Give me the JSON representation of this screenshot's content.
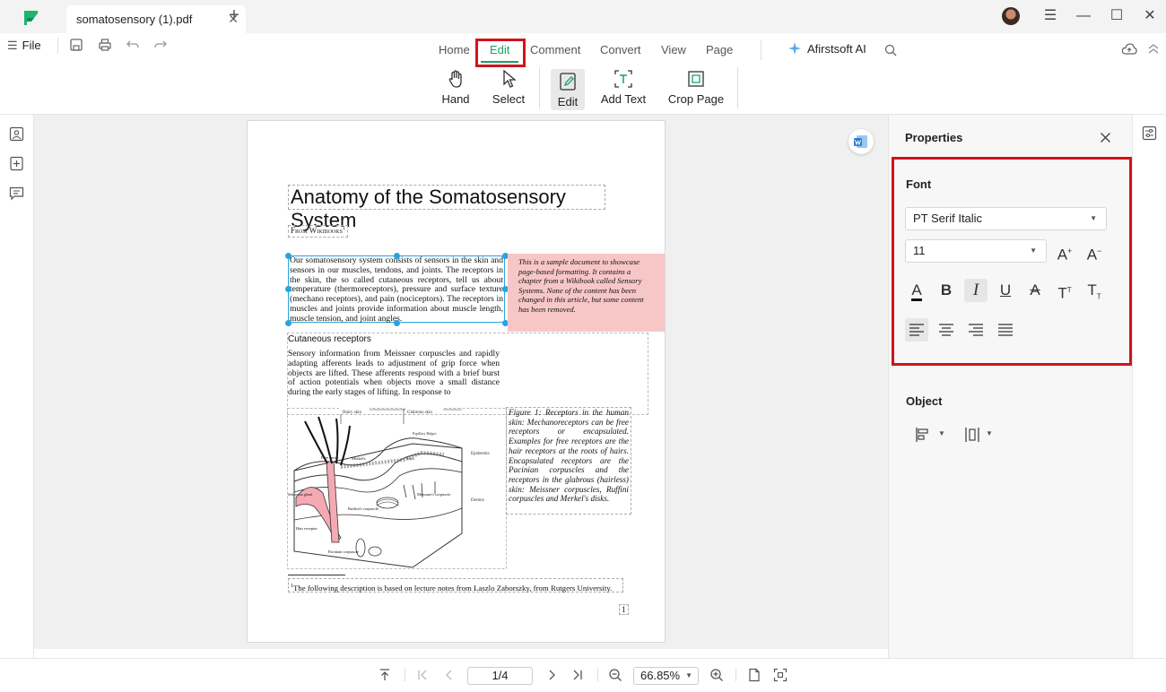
{
  "tab": {
    "title": "somatosensory (1).pdf",
    "close_glyph": "✕",
    "new_glyph": "+"
  },
  "window": {
    "menu_glyph": "☰",
    "minimize_glyph": "—",
    "maximize_glyph": "☐",
    "close_glyph": "✕"
  },
  "menubar": {
    "file_label": "File",
    "tabs": [
      {
        "label": "Home"
      },
      {
        "label": "Edit"
      },
      {
        "label": "Comment"
      },
      {
        "label": "Convert"
      },
      {
        "label": "View"
      },
      {
        "label": "Page"
      }
    ],
    "ai_label": "Afirstsoft AI",
    "accent_color": "#13a36a",
    "highlight_color": "#d0141b"
  },
  "toolbar": {
    "tools": [
      {
        "label": "Hand",
        "icon": "hand-icon"
      },
      {
        "label": "Select",
        "icon": "cursor-icon"
      },
      {
        "label": "Edit",
        "icon": "edit-icon"
      },
      {
        "label": "Add Text",
        "icon": "add-text-icon"
      },
      {
        "label": "Crop Page",
        "icon": "crop-icon"
      }
    ]
  },
  "document": {
    "title": "Anatomy of the Somatosensory System",
    "from": "From Wikibooks",
    "from_sup": "1",
    "para1": "Our somatosensory system consists of sensors in the skin and sensors in our muscles, tendons, and joints. The receptors in the skin, the so called cutaneous receptors, tell us about temperature (thermoreceptors), pressure and surface texture (mechano receptors), and pain (nociceptors). The receptors in muscles and joints provide information about muscle length, muscle tension, and joint angles.",
    "note": "This is a sample document to showcase page-based formatting. It contains a chapter from a Wikibook called Sensory Systems. None of the content has been changed in this article, but some content has been removed.",
    "heading": "Cutaneous receptors",
    "para2": "Sensory information from Meissner corpuscles and rapidly adapting afferents leads to adjustment of grip force when objects are lifted. These afferents respond with a brief burst of action potentials when objects move a small distance during the early stages of lifting. In response to",
    "caption": "Figure 1: Receptors in the human skin: Mechanoreceptors can be free receptors or encapsulated. Examples for free receptors are the hair receptors at the roots of hairs. Encapsulated receptors are the Pacinian corpuscles and the receptors in the glabrous (hairless) skin: Meissner corpuscles, Ruffini corpuscles and Merkel's disks.",
    "figure_labels": {
      "hairy": "Hairy skin",
      "glabrous": "Glabrous skin",
      "epidermis": "Epidermis",
      "dermis": "Dermis",
      "free_nerve": "Free nerve",
      "merkel": "Merkel's",
      "ruffini": "Ruffini's corpuscle",
      "meissner": "Meissner's corpuscle",
      "sebaceous": "Sebaceous gland",
      "hair_receptor": "Hair receptor",
      "pacinian": "Pacinian corpuscle",
      "papillary": "Papillary Ridges",
      "septa": "Septa"
    },
    "footnote_sup": "1",
    "footnote": "The following description is based on lecture notes from Laszlo Zaborszky, from Rutgers University.",
    "page_number": "1",
    "note_color": "#f7c7c7",
    "selection_color": "#29a3e0"
  },
  "properties": {
    "title": "Properties",
    "font_label": "Font",
    "font_family": "PT Serif Italic",
    "font_size": "11",
    "object_label": "Object",
    "format_buttons": [
      {
        "icon": "text-color-icon"
      },
      {
        "icon": "bold-icon"
      },
      {
        "icon": "italic-icon"
      },
      {
        "icon": "underline-icon"
      },
      {
        "icon": "strikethrough-icon"
      },
      {
        "icon": "superscript-icon"
      },
      {
        "icon": "subscript-icon"
      }
    ],
    "align_buttons": [
      {
        "icon": "align-left-icon"
      },
      {
        "icon": "align-center-icon"
      },
      {
        "icon": "align-right-icon"
      },
      {
        "icon": "align-justify-icon"
      }
    ]
  },
  "status": {
    "page_display": "1/4",
    "zoom": "66.85%"
  }
}
